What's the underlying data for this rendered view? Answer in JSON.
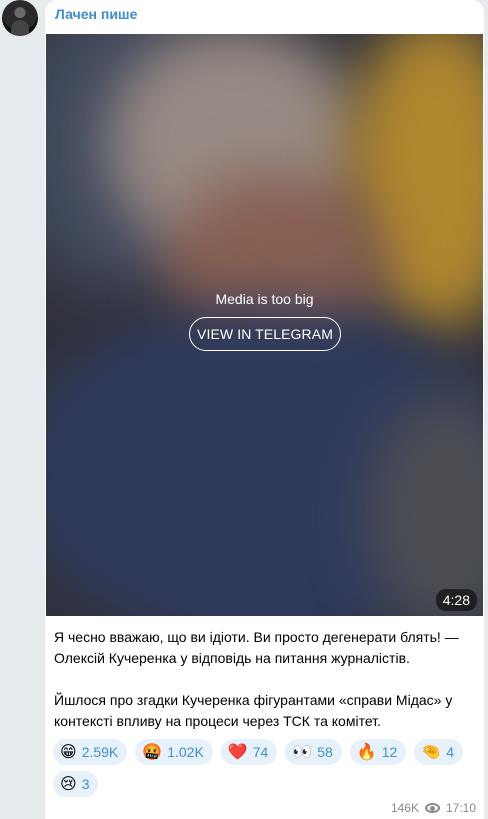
{
  "author": "Лачен пише",
  "media": {
    "notice": "Media is too big",
    "button_label": "VIEW IN TELEGRAM",
    "duration": "4:28"
  },
  "message": {
    "paragraph1": "Я чесно вважаю, що ви ідіоти. Ви просто дегенерати блять! — Олексій Кучеренка у відповідь на питання журналістів.",
    "paragraph2": "Йшлося про згадки Кучеренка фігурантами «справи Мідас» у контексті впливу на процеси через ТСК та комітет."
  },
  "reactions": [
    {
      "emoji": "😁",
      "count": "2.59K"
    },
    {
      "emoji": "🤬",
      "count": "1.02K"
    },
    {
      "emoji": "❤️",
      "count": "74"
    },
    {
      "emoji": "👀",
      "count": "58"
    },
    {
      "emoji": "🔥",
      "count": "12"
    },
    {
      "emoji": "🤏",
      "count": "4"
    },
    {
      "emoji": "😢",
      "count": "3"
    }
  ],
  "footer": {
    "views": "146K",
    "time": "17:10"
  },
  "colors": {
    "accent": "#3d8fd1",
    "background": "#e6ebee"
  }
}
